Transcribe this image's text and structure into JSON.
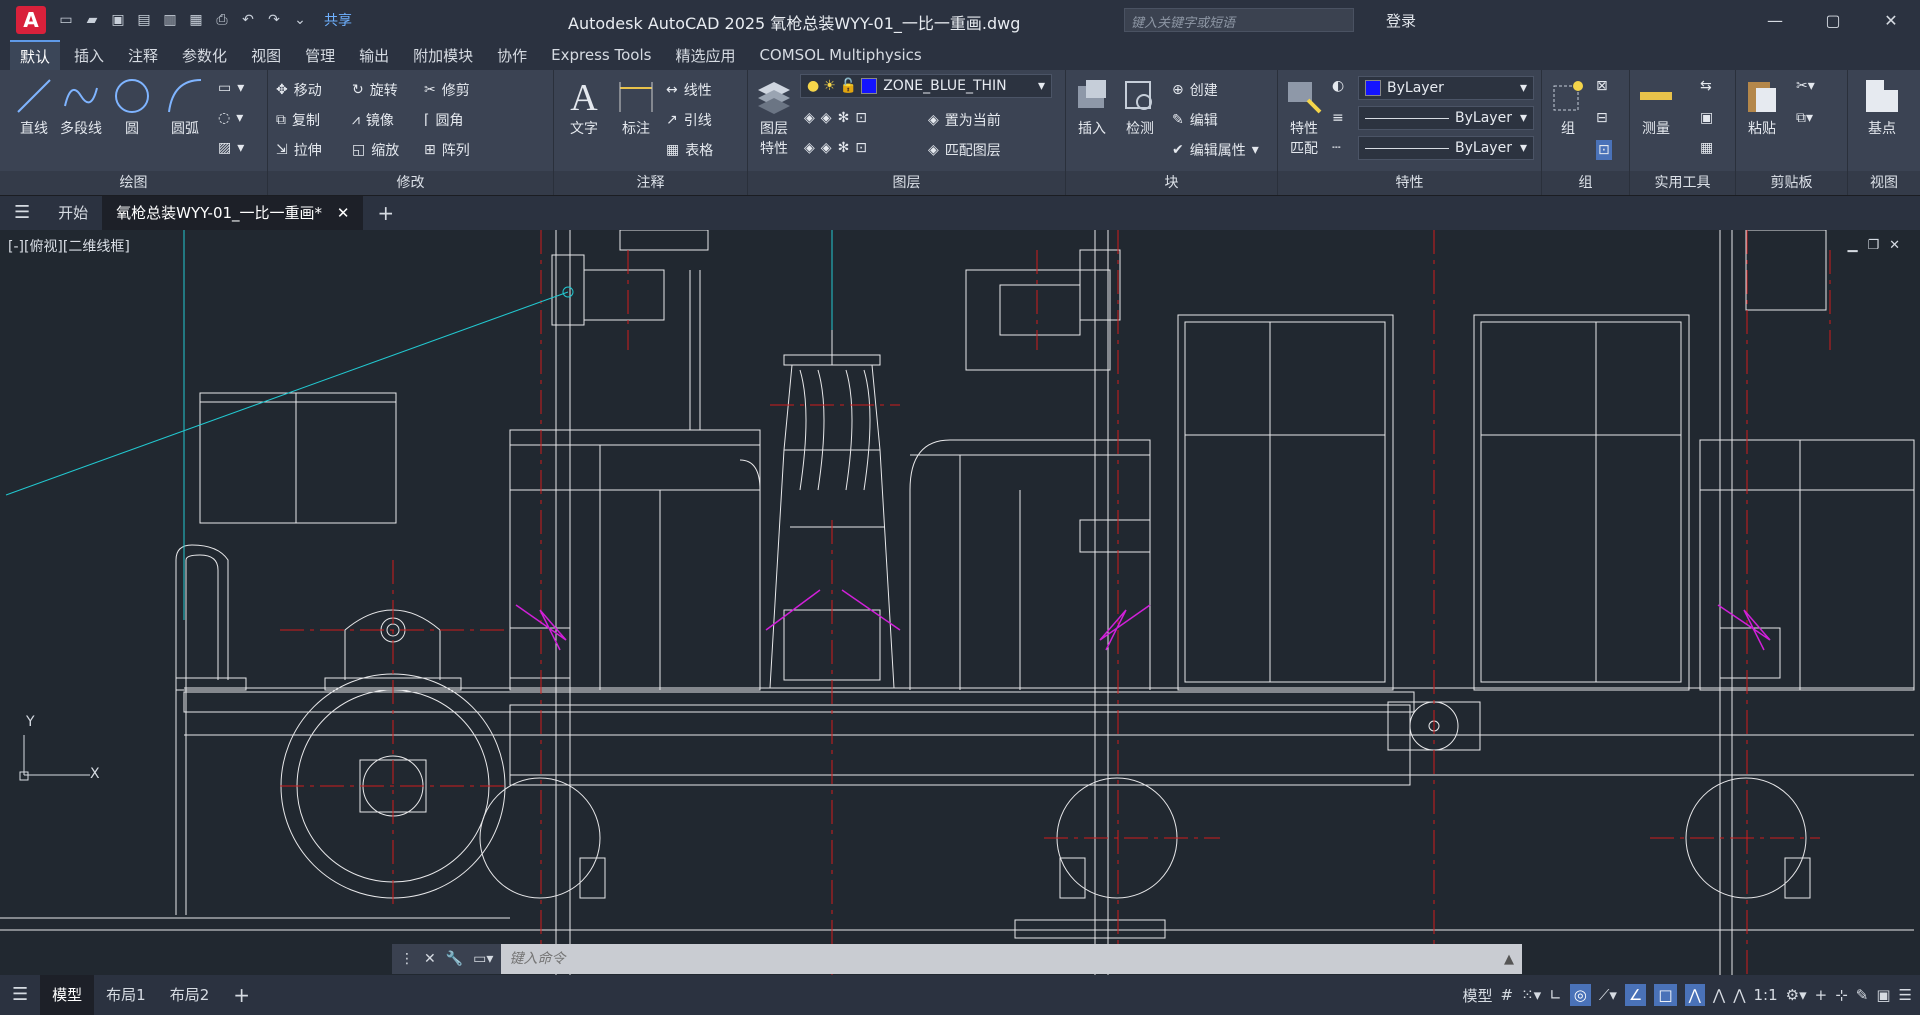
{
  "titlebar": {
    "logo": "A",
    "share": "共享",
    "title": "Autodesk AutoCAD 2025    氧枪总装WYY-01_一比一重画.dwg",
    "search_placeholder": "键入关键字或短语",
    "login": "登录"
  },
  "ribbon_tabs": [
    "默认",
    "插入",
    "注释",
    "参数化",
    "视图",
    "管理",
    "输出",
    "附加模块",
    "协作",
    "Express Tools",
    "精选应用",
    "COMSOL Multiphysics"
  ],
  "draw_panel": {
    "title": "绘图",
    "line": "直线",
    "polyline": "多段线",
    "circle": "圆",
    "arc": "圆弧"
  },
  "modify_panel": {
    "title": "修改",
    "move": "移动",
    "rotate": "旋转",
    "trim": "修剪",
    "copy": "复制",
    "mirror": "镜像",
    "fillet": "圆角",
    "stretch": "拉伸",
    "scale": "缩放",
    "array": "阵列"
  },
  "annotation_panel": {
    "title": "注释",
    "text": "文字",
    "dimension": "标注",
    "linear": "线性",
    "leader": "引线",
    "table": "表格"
  },
  "layers_panel": {
    "title": "图层",
    "layer_properties": "图层\n特性",
    "current_layer": "ZONE_BLUE_THIN",
    "set_current": "置为当前",
    "match_layer": "匹配图层"
  },
  "block_panel": {
    "title": "块",
    "insert": "插入",
    "inspect": "检测",
    "create": "创建",
    "edit": "编辑",
    "edit_attributes": "编辑属性"
  },
  "properties_panel": {
    "title": "特性",
    "match": "特性\n匹配",
    "color": "ByLayer",
    "linetype": "ByLayer",
    "lineweight": "ByLayer"
  },
  "group_panel": {
    "title": "组",
    "group": "组"
  },
  "utilities_panel": {
    "title": "实用工具",
    "measure": "测量"
  },
  "clipboard_panel": {
    "title": "剪贴板",
    "paste": "粘贴"
  },
  "view_panel": {
    "title": "视图",
    "base": "基点"
  },
  "doc_tabs": {
    "start": "开始",
    "active": "氧枪总装WYY-01_一比一重画*"
  },
  "viewport": {
    "label": "[-][俯视][二维线框]"
  },
  "command": {
    "placeholder": "键入命令"
  },
  "status": {
    "model": "模型",
    "layout1": "布局1",
    "layout2": "布局2",
    "model_indicator": "模型",
    "scale": "1:1"
  },
  "colors": {
    "background": "#212830",
    "accent": "#5f9ae8",
    "red": "#d01c1c",
    "cyan": "#22c8d0",
    "magenta": "#d020d8"
  }
}
